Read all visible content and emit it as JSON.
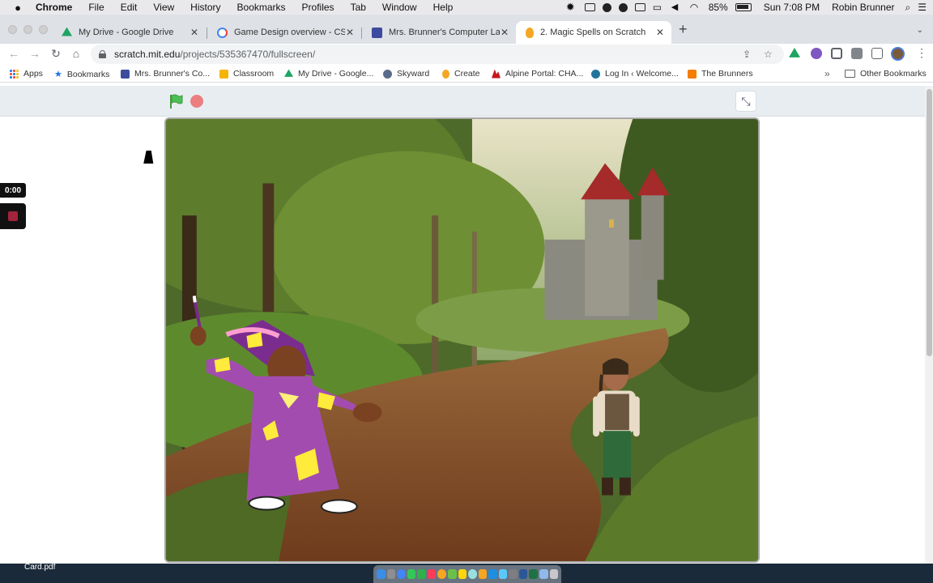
{
  "menubar": {
    "app": "Chrome",
    "items": [
      "File",
      "Edit",
      "View",
      "History",
      "Bookmarks",
      "Profiles",
      "Tab",
      "Window",
      "Help"
    ],
    "battery": "85%",
    "clock": "Sun 7:08 PM",
    "user": "Robin Brunner"
  },
  "tabs": [
    {
      "label": "My Drive - Google Drive",
      "icon": "google-drive-icon",
      "color": "#1fa463"
    },
    {
      "label": "Game Design overview - CS Fi",
      "icon": "google-icon",
      "color": "#4285f4"
    },
    {
      "label": "Mrs. Brunner's Computer Lab",
      "icon": "google-sites-icon",
      "color": "#3c4b9e"
    },
    {
      "label": "2. Magic Spells on Scratch",
      "icon": "scratch-icon",
      "color": "#f5a623"
    }
  ],
  "toolbar": {
    "url_domain": "scratch.mit.edu",
    "url_path": "/projects/535367470/fullscreen/"
  },
  "bookmarks": [
    {
      "label": "Apps",
      "icon": "apps-grid-icon"
    },
    {
      "label": "Bookmarks",
      "icon": "star-icon",
      "color": "#1a73e8"
    },
    {
      "label": "Mrs. Brunner's Co...",
      "icon": "google-sites-icon",
      "color": "#3c4b9e"
    },
    {
      "label": "Classroom",
      "icon": "classroom-icon",
      "color": "#f4b400"
    },
    {
      "label": "My Drive - Google...",
      "icon": "google-drive-icon",
      "color": "#1fa463"
    },
    {
      "label": "Skyward",
      "icon": "skyward-icon",
      "color": "#5a6b8c"
    },
    {
      "label": "Create",
      "icon": "scratch-icon",
      "color": "#f5a623"
    },
    {
      "label": "Alpine Portal: CHA...",
      "icon": "alpine-icon",
      "color": "#c4161c"
    },
    {
      "label": "Log In ‹ Welcome...",
      "icon": "wordpress-icon",
      "color": "#21759b"
    },
    {
      "label": "The Brunners",
      "icon": "blogger-icon",
      "color": "#f57d00"
    }
  ],
  "other_bookmarks": "Other Bookmarks",
  "recorder": {
    "time": "0:00"
  },
  "desktop": {
    "file": "Card.pdf"
  }
}
